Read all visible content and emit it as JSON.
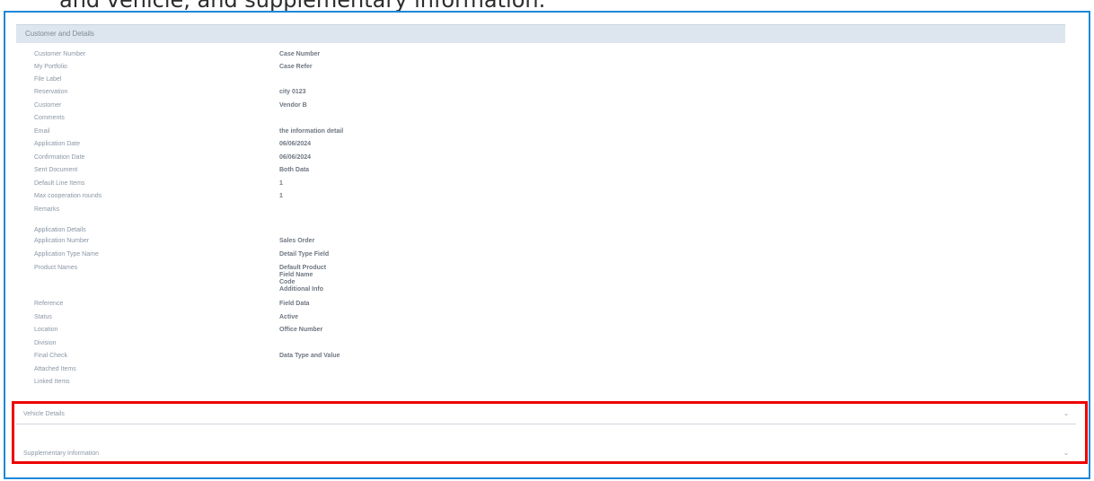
{
  "caption": "and vehicle, and supplementary information.",
  "section": {
    "title": "Customer and Details"
  },
  "fields": [
    {
      "label": "Customer Number",
      "value": "Case Number"
    },
    {
      "label": "My Portfolio",
      "value": "Case Refer"
    },
    {
      "label": "File Label",
      "value": ""
    },
    {
      "label": "Reservation",
      "value": "city 0123"
    },
    {
      "label": "Customer",
      "value": "Vendor B"
    },
    {
      "label": "Comments",
      "value": ""
    },
    {
      "label": "Email",
      "value": "the information detail"
    },
    {
      "label": "Application Date",
      "value": "06/06/2024"
    },
    {
      "label": "Confirmation Date",
      "value": "06/06/2024"
    },
    {
      "label": "Sent Document",
      "value": "Both Data"
    },
    {
      "label": "Default Line Items",
      "value": "1"
    },
    {
      "label": "Max cooperation rounds",
      "value": "1"
    },
    {
      "label": "Remarks",
      "value": ""
    }
  ],
  "application": {
    "subheading": "Application Details",
    "fields": [
      {
        "label": "Application Number",
        "value": "Sales Order"
      },
      {
        "label": "Application Type Name",
        "value": "Detail Type Field"
      },
      {
        "label": "Product Names",
        "lines": [
          "Default Product",
          "Field Name",
          "Code",
          "Additional Info"
        ]
      },
      {
        "label": "Reference",
        "value": "Field Data"
      },
      {
        "label": "Status",
        "value": "Active"
      },
      {
        "label": "Location",
        "value": "Office Number"
      },
      {
        "label": "Division",
        "value": ""
      },
      {
        "label": "Final Check",
        "value": "Data Type and Value"
      },
      {
        "label": "Attached Items",
        "value": ""
      },
      {
        "label": "Linked Items",
        "value": ""
      }
    ]
  },
  "collapsibles": [
    {
      "title": "Vehicle Details",
      "chevron": "⌄"
    },
    {
      "title": "Supplementary Information",
      "chevron": "⌄"
    }
  ]
}
